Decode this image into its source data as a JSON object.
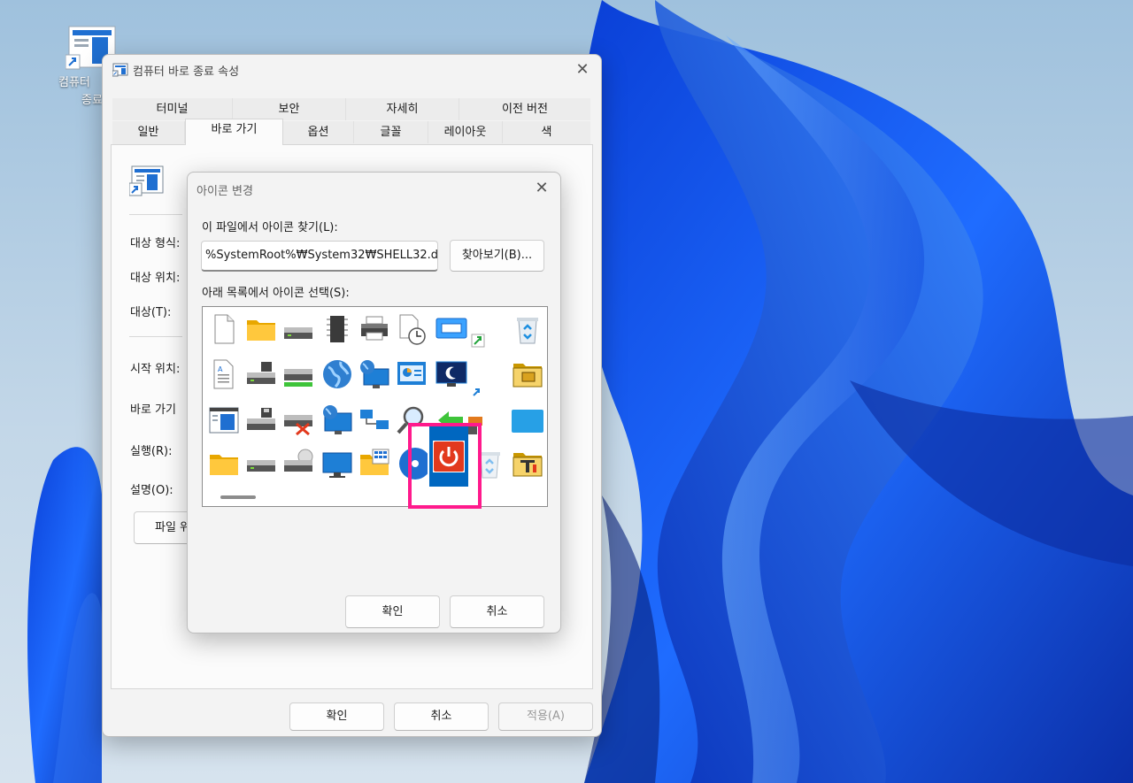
{
  "desktop": {
    "shortcut_label_line1": "컴퓨터",
    "shortcut_label_line2": "종료"
  },
  "properties": {
    "title": "컴퓨터 바로 종료 속성",
    "tabs_row1": [
      "터미널",
      "보안",
      "자세히",
      "이전 버전"
    ],
    "tabs_row2": [
      "일반",
      "바로 가기",
      "옵션",
      "글꼴",
      "레이아웃",
      "색"
    ],
    "active_tab": "바로 가기",
    "labels": {
      "target_type": "대상 형식:",
      "target_location": "대상 위치:",
      "target": "대상(T):",
      "start_in": "시작 위치:",
      "shortcut_key": "바로 가기",
      "run": "실행(R):",
      "comment": "설명(O):"
    },
    "open_file_button": "파일 위",
    "ok": "확인",
    "cancel": "취소",
    "apply": "적용(A)"
  },
  "change_icon": {
    "title": "아이콘 변경",
    "find_label": "이 파일에서 아이콘 찾기(L):",
    "file_path": "%SystemRoot%₩System32₩SHELL32.dll",
    "browse": "찾아보기(B)...",
    "select_label": "아래 목록에서 아이콘 선택(S):",
    "ok": "확인",
    "cancel": "취소",
    "icons": [
      [
        "blank-document-icon",
        "folder-icon",
        "drive-icon",
        "chip-icon",
        "printer-icon",
        "document-clock-icon",
        "window-shortcut-icon",
        "recycle-bin-full-icon"
      ],
      [
        "text-document-icon",
        "floppy-drive-icon",
        "removable-drive-icon",
        "globe-icon",
        "network-globe-icon",
        "control-panel-icon",
        "sleep-monitor-icon",
        "briefcase-folder-icon"
      ],
      [
        "application-window-icon",
        "floppy-disk-drive-icon",
        "drive-error-icon",
        "monitor-globe-icon",
        "network-computers-icon",
        "search-magnifier-icon",
        "back-arrow-icon",
        "blue-panel-icon"
      ],
      [
        "folder-empty-icon",
        "hard-drive-icon",
        "cd-drive-icon",
        "monitor-icon",
        "folder-grid-icon",
        "blue-circle-icon",
        "power-button-icon",
        "recycle-bin-empty-icon",
        "tools-folder-icon"
      ]
    ],
    "selected_icon": "power-button-icon"
  },
  "colors": {
    "highlight": "#ff1a8c",
    "selection": "#0067c0",
    "power_red": "#e2391d"
  }
}
